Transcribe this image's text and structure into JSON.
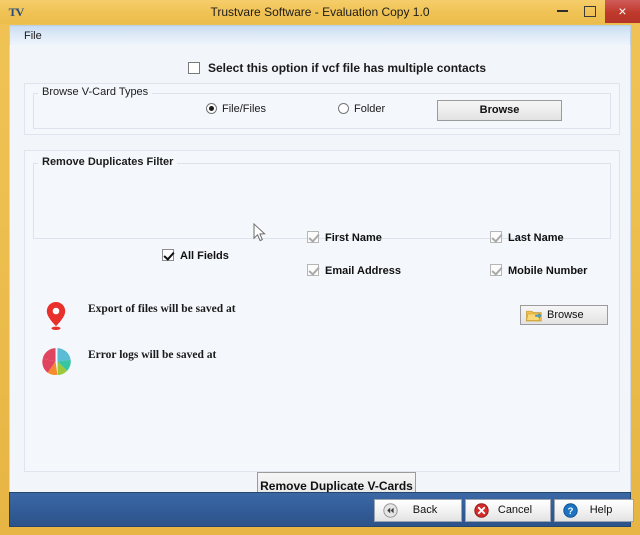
{
  "window": {
    "icon_label": "TV",
    "title": "Trustvare Software - Evaluation Copy 1.0",
    "controls": {
      "minimize": "minimize-icon",
      "maximize": "maximize-icon",
      "close": "×"
    },
    "frame_color": "#edbf4e",
    "close_color": "#c0392b"
  },
  "menubar": {
    "items": [
      {
        "label": "File"
      }
    ]
  },
  "main": {
    "multiple_contacts_option": {
      "label": "Select this option if vcf file has multiple contacts",
      "checked": false
    },
    "browse_types_group": {
      "title": "Browse V-Card Types",
      "radios": [
        {
          "label": "File/Files",
          "selected": true
        },
        {
          "label": "Folder",
          "selected": false
        }
      ],
      "browse_button": "Browse"
    },
    "duplicates_group": {
      "title": "Remove Duplicates Filter",
      "all_fields": {
        "label": "All Fields",
        "checked": true,
        "enabled": true
      },
      "fields": [
        {
          "label": "First Name",
          "checked": true,
          "enabled": false
        },
        {
          "label": "Last Name",
          "checked": true,
          "enabled": false
        },
        {
          "label": "Email Address",
          "checked": true,
          "enabled": false
        },
        {
          "label": "Mobile Number",
          "checked": true,
          "enabled": false
        }
      ]
    },
    "export_row": {
      "icon": "location-pin-icon",
      "label": "Export of files will be saved at",
      "browse_button": "Browse"
    },
    "error_row": {
      "icon": "pie-chart-icon",
      "label": "Error logs will be saved at"
    },
    "action_button": "Remove Duplicate V-Cards"
  },
  "footer": {
    "bar_color": "#335e99",
    "buttons": [
      {
        "label": "Back",
        "icon": "rewind-icon"
      },
      {
        "label": "Cancel",
        "icon": "close-circle-icon"
      },
      {
        "label": "Help",
        "icon": "question-circle-icon"
      }
    ]
  }
}
